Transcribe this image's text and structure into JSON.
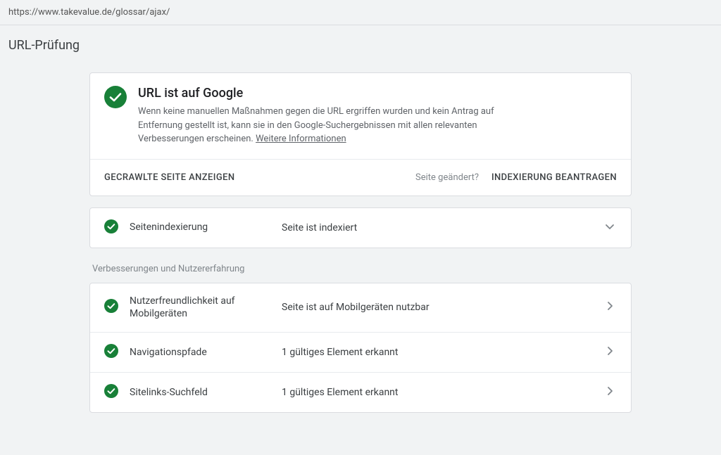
{
  "url": "https://www.takevalue.de/glossar/ajax/",
  "page_title": "URL-Prüfung",
  "colors": {
    "check_green": "#188038",
    "chevron_grey": "#80868b"
  },
  "status": {
    "title": "URL ist auf Google",
    "description": "Wenn keine manuellen Maßnahmen gegen die URL ergriffen wurden und kein Antrag auf Entfernung gestellt ist, kann sie in den Google-Suchergebnissen mit allen relevanten Verbesserungen erscheinen. ",
    "more_info": "Weitere Informationen"
  },
  "actions": {
    "view_crawled": "GECRAWLTE SEITE ANZEIGEN",
    "changed_hint": "Seite geändert?",
    "request_index": "INDEXIERUNG BEANTRAGEN"
  },
  "indexing": {
    "label": "Seitenindexierung",
    "value": "Seite ist indexiert"
  },
  "enhancements_heading": "Verbesserungen und Nutzererfahrung",
  "enhancements": [
    {
      "label": "Nutzerfreundlichkeit auf Mobilgeräten",
      "value": "Seite ist auf Mobilgeräten nutzbar"
    },
    {
      "label": "Navigationspfade",
      "value": "1 gültiges Element erkannt"
    },
    {
      "label": "Sitelinks-Suchfeld",
      "value": "1 gültiges Element erkannt"
    }
  ]
}
